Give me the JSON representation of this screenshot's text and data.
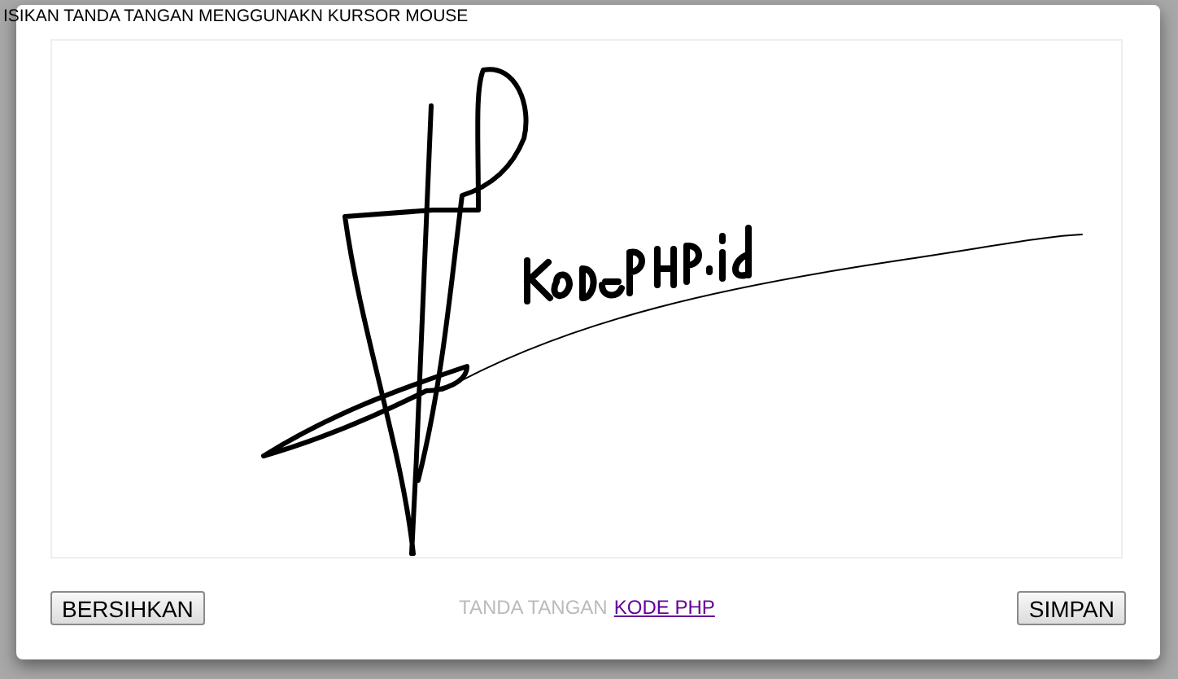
{
  "heading": "ISIKAN TANDA TANGAN MENGGUNAKN KURSOR MOUSE",
  "signature_pad": {
    "kind": "drawing"
  },
  "buttons": [
    {
      "label": "BERSIHKAN"
    },
    {
      "label": "SIMPAN"
    }
  ],
  "footer": {
    "text": "TANDA TANGAN",
    "link": "KODE PHP"
  }
}
